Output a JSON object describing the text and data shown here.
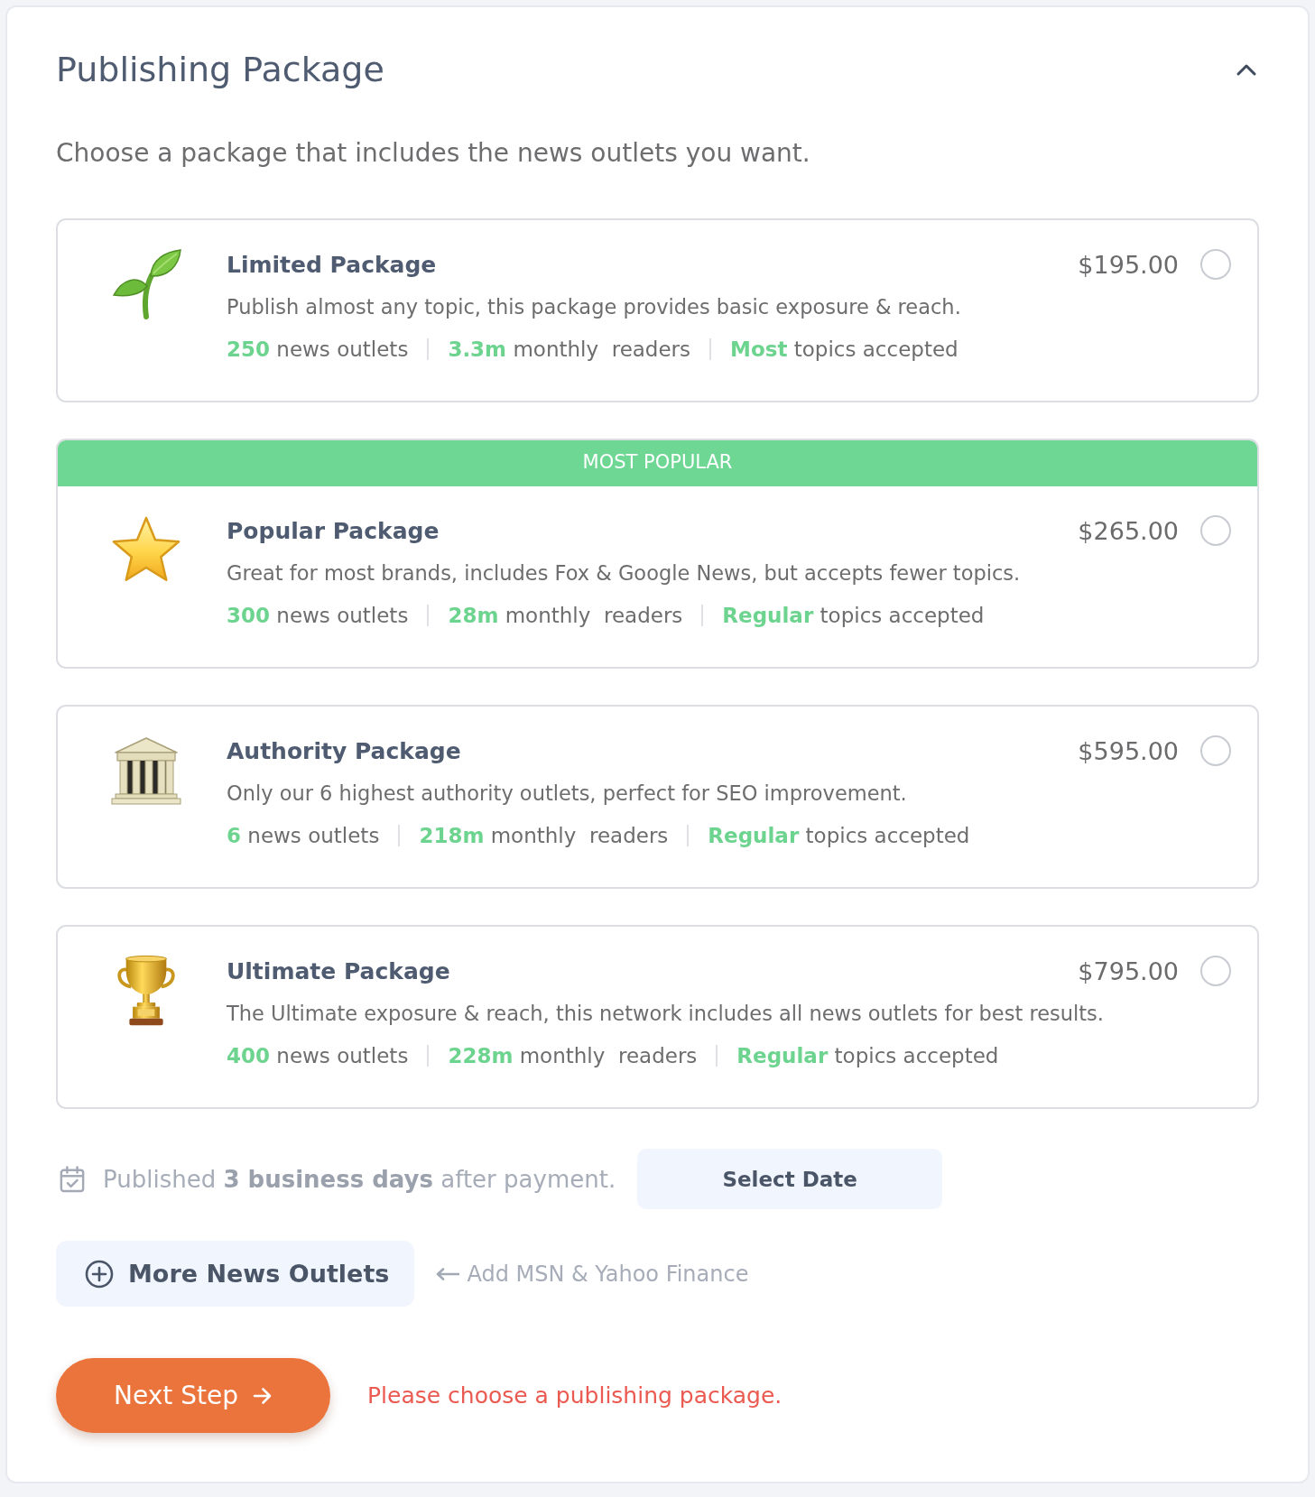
{
  "header": {
    "title": "Publishing Package",
    "expanded": true
  },
  "intro": "Choose a package that includes the news outlets you want.",
  "packages": [
    {
      "name": "Limited Package",
      "price": "$195.00",
      "selected": false,
      "description": "Publish almost any topic, this package provides basic exposure & reach.",
      "stats": [
        "**250** news outlets",
        "**3.3m** monthly  readers",
        "**Most** topics accepted"
      ]
    },
    {
      "badge": "MOST POPULAR",
      "name": "Popular Package",
      "price": "$265.00",
      "selected": false,
      "description": "Great for most brands, includes Fox & Google News, but accepts fewer topics.",
      "stats": [
        "**300** news outlets",
        "**28m** monthly  readers",
        "**Regular** topics accepted"
      ]
    },
    {
      "name": "Authority Package",
      "price": "$595.00",
      "selected": false,
      "description": "Only our 6 highest authority outlets, perfect for SEO improvement.",
      "stats": [
        "**6** news outlets",
        "**218m** monthly  readers",
        "**Regular** topics accepted"
      ]
    },
    {
      "name": "Ultimate Package",
      "price": "$795.00",
      "selected": false,
      "description": "The Ultimate exposure & reach, this network includes all news outlets for best results.",
      "stats": [
        "**400** news outlets",
        "**228m** monthly  readers",
        "**Regular** topics accepted"
      ]
    }
  ],
  "schedule": {
    "text": "Published **3 business days** after payment.",
    "button": "Select Date"
  },
  "more_outlets": {
    "button": "More News Outlets",
    "hint": "Add MSN & Yahoo Finance"
  },
  "next_button": "Next Step",
  "error": "Please choose a publishing package."
}
